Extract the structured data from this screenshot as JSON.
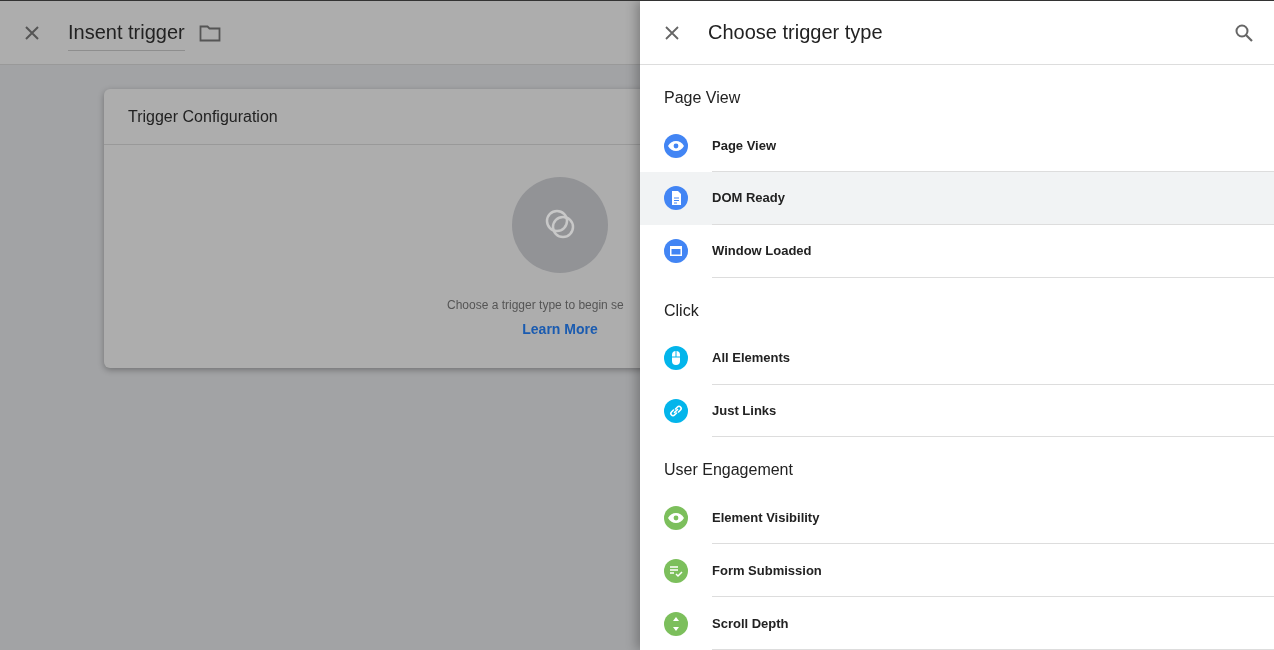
{
  "editor": {
    "title": "Insent trigger",
    "card": {
      "title": "Trigger Configuration",
      "hint": "Choose a trigger type to begin se",
      "link": "Learn More"
    }
  },
  "panel": {
    "title": "Choose trigger type",
    "sections": [
      {
        "title": "Page View",
        "items": [
          {
            "label": "Page View",
            "kind": "eye",
            "color": "#4285f4",
            "selected": false
          },
          {
            "label": "DOM Ready",
            "kind": "document",
            "color": "#4285f4",
            "selected": true
          },
          {
            "label": "Window Loaded",
            "kind": "window",
            "color": "#4285f4",
            "selected": false
          }
        ]
      },
      {
        "title": "Click",
        "items": [
          {
            "label": "All Elements",
            "kind": "mouse",
            "color": "#03b5eb",
            "selected": false
          },
          {
            "label": "Just Links",
            "kind": "link",
            "color": "#03b5eb",
            "selected": false
          }
        ]
      },
      {
        "title": "User Engagement",
        "items": [
          {
            "label": "Element Visibility",
            "kind": "eye",
            "color": "#7cbf5c",
            "selected": false
          },
          {
            "label": "Form Submission",
            "kind": "form",
            "color": "#7cbf5c",
            "selected": false
          },
          {
            "label": "Scroll Depth",
            "kind": "scroll",
            "color": "#7cbf5c",
            "selected": false
          }
        ]
      }
    ]
  }
}
